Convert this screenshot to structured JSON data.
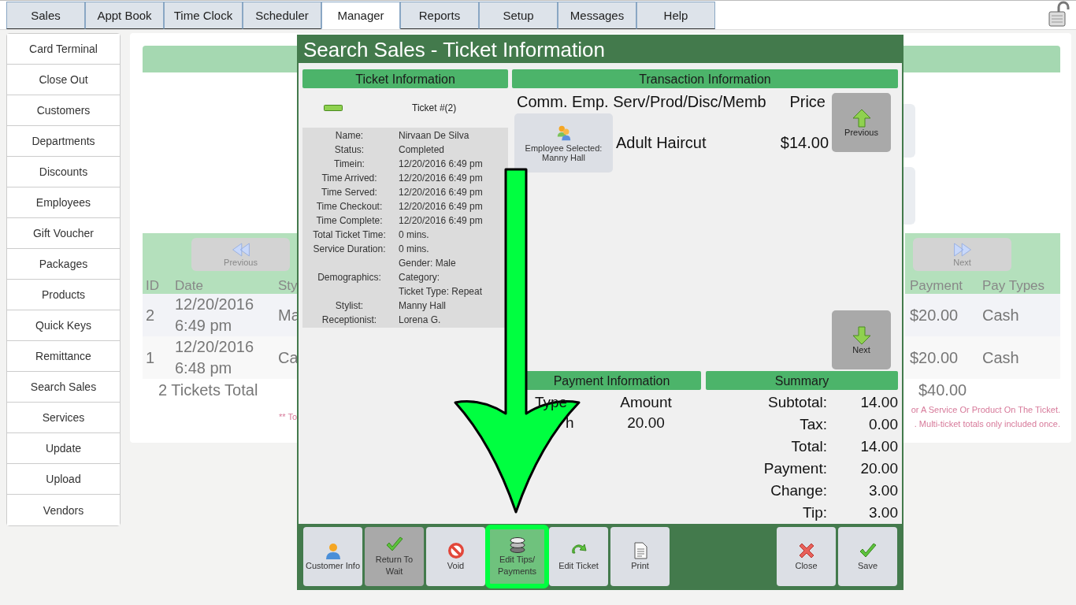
{
  "tabs": [
    {
      "label": "Sales",
      "selected": false
    },
    {
      "label": "Appt Book",
      "selected": false
    },
    {
      "label": "Time Clock",
      "selected": false
    },
    {
      "label": "Scheduler",
      "selected": false
    },
    {
      "label": "Manager",
      "selected": true
    },
    {
      "label": "Reports",
      "selected": false
    },
    {
      "label": "Setup",
      "selected": false
    },
    {
      "label": "Messages",
      "selected": false
    },
    {
      "label": "Help",
      "selected": false
    }
  ],
  "sidebar": {
    "items": [
      {
        "label": "Card Terminal"
      },
      {
        "label": "Close Out"
      },
      {
        "label": "Customers"
      },
      {
        "label": "Departments"
      },
      {
        "label": "Discounts"
      },
      {
        "label": "Employees"
      },
      {
        "label": "Gift Voucher"
      },
      {
        "label": "Packages"
      },
      {
        "label": "Products"
      },
      {
        "label": "Quick Keys"
      },
      {
        "label": "Remittance"
      },
      {
        "label": "Search Sales"
      },
      {
        "label": "Services"
      },
      {
        "label": "Update"
      },
      {
        "label": "Upload"
      },
      {
        "label": "Vendors"
      }
    ]
  },
  "results": {
    "previous": "Previous",
    "next": "Next",
    "columns_left": [
      "ID",
      "Date",
      "Sty"
    ],
    "columns_right": [
      "Payment",
      "Pay Types"
    ],
    "rows": [
      {
        "id": "2",
        "date": "12/20/2016 6:49 pm",
        "column_3": "Ma",
        "payment": "$20.00",
        "pay_type": "Cash"
      },
      {
        "id": "1",
        "date": "12/20/2016 6:48 pm",
        "column_3": "Ca",
        "payment": "$20.00",
        "pay_type": "Cash"
      }
    ],
    "total_count": "2 Tickets Total",
    "total_amount": "$40.00",
    "note_left": "** To",
    "notes_right": [
      "or A Service Or Product On The Ticket.",
      ". Multi-ticket totals only included once."
    ]
  },
  "modal": {
    "title": "Search Sales - Ticket Information",
    "ticket": {
      "heading": "Ticket Information",
      "number": "Ticket #(2)",
      "fields": [
        {
          "label": "Name:",
          "values": [
            "Nirvaan De Silva"
          ]
        },
        {
          "label": "Status:",
          "values": [
            "Completed"
          ]
        },
        {
          "label": "Timein:",
          "values": [
            "12/20/2016 6:49 pm"
          ]
        },
        {
          "label": "Time Arrived:",
          "values": [
            "12/20/2016 6:49 pm"
          ]
        },
        {
          "label": "Time Served:",
          "values": [
            "12/20/2016 6:49 pm"
          ]
        },
        {
          "label": "Time Checkout:",
          "values": [
            "12/20/2016 6:49 pm"
          ]
        },
        {
          "label": "Time Complete:",
          "values": [
            "12/20/2016 6:49 pm"
          ]
        },
        {
          "label": "Total Ticket Time:",
          "values": [
            "0 mins."
          ]
        },
        {
          "label": "Service Duration:",
          "values": [
            "0 mins."
          ]
        },
        {
          "label": "Demographics:",
          "values": [
            "Gender: Male",
            "Category:",
            "Ticket Type: Repeat"
          ]
        },
        {
          "label": "Stylist:",
          "values": [
            "Manny Hall"
          ]
        },
        {
          "label": "Receptionist:",
          "values": [
            "Lorena G."
          ]
        }
      ]
    },
    "transaction": {
      "heading": "Transaction Information",
      "column_header": "Comm. Emp. Serv/Prod/Disc/Memb",
      "price_header": "Price",
      "items": [
        {
          "employee": "Employee Selected: Manny Hall",
          "service": "Adult Haircut",
          "price": "$14.00"
        }
      ],
      "previous": "Previous",
      "next": "Next"
    },
    "payment": {
      "heading": "Payment Information",
      "columns": [
        "Type",
        "Amount"
      ],
      "rows": [
        {
          "type": "h",
          "amount": "20.00"
        }
      ]
    },
    "summary": {
      "heading": "Summary",
      "lines": [
        {
          "label": "Subtotal:",
          "value": "14.00"
        },
        {
          "label": "Tax:",
          "value": "0.00"
        },
        {
          "label": "Total:",
          "value": "14.00"
        },
        {
          "label": "Payment:",
          "value": "20.00"
        },
        {
          "label": "Change:",
          "value": "3.00"
        },
        {
          "label": "Tip:",
          "value": "3.00"
        }
      ]
    },
    "left_buttons": [
      {
        "label": "Customer Info",
        "kind": "person",
        "disabled": false,
        "highlighted": false
      },
      {
        "label": "Return To Wait",
        "kind": "check",
        "disabled": true,
        "highlighted": false
      },
      {
        "label": "Void",
        "kind": "void",
        "disabled": false,
        "highlighted": false
      },
      {
        "label": "Edit Tips/ Payments",
        "kind": "coins",
        "disabled": false,
        "highlighted": true
      },
      {
        "label": "Edit Ticket",
        "kind": "redo",
        "disabled": false,
        "highlighted": false
      },
      {
        "label": "Print",
        "kind": "page",
        "disabled": false,
        "highlighted": false
      }
    ],
    "right_buttons": [
      {
        "label": "Close",
        "kind": "close",
        "disabled": false,
        "highlighted": false
      },
      {
        "label": "Save",
        "kind": "check",
        "disabled": false,
        "highlighted": false
      }
    ]
  }
}
